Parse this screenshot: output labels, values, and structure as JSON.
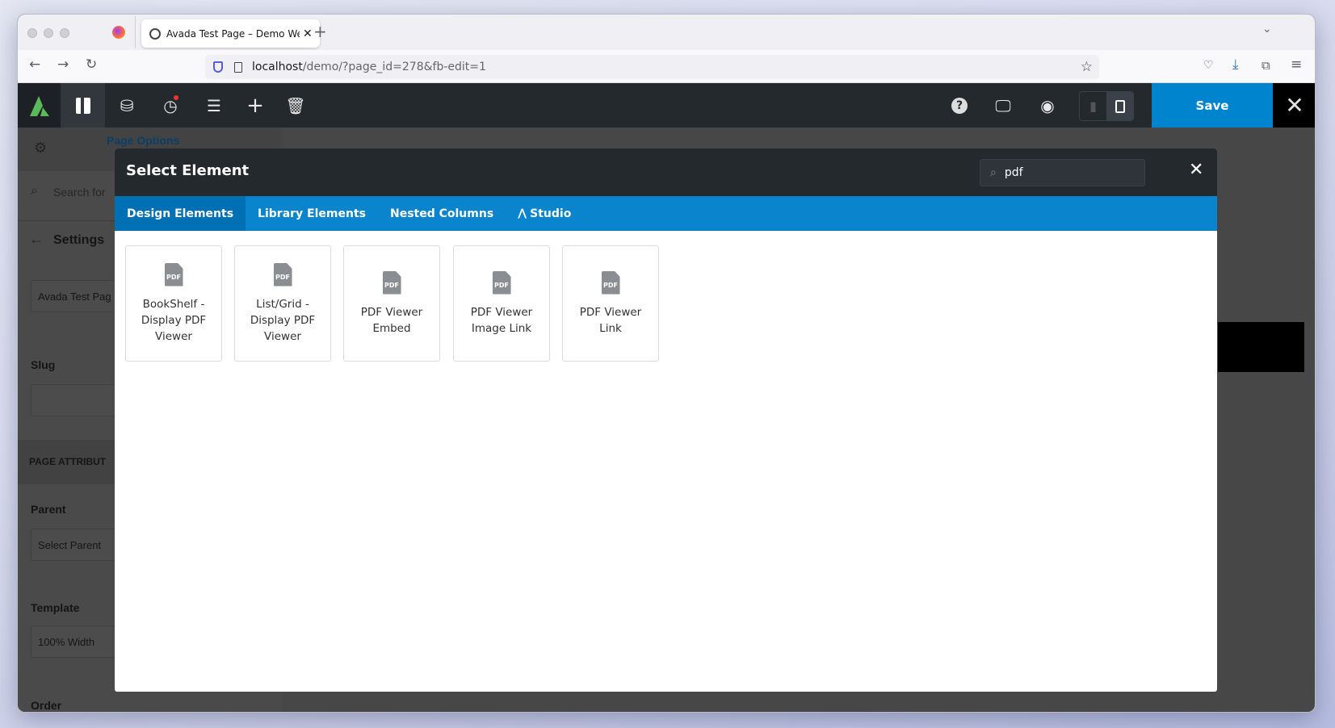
{
  "browser": {
    "tab_title": "Avada Test Page – Demo Websit",
    "url_host": "localhost",
    "url_path": "/demo/?page_id=278&fb-edit=1"
  },
  "toolbar": {
    "save_label": "Save"
  },
  "sidebar": {
    "tab_label": "Page Options",
    "search_placeholder": "Search for",
    "back_title": "Settings",
    "title_value": "Avada Test Pag",
    "slug_label": "Slug",
    "section_title": "PAGE ATTRIBUT",
    "parent_label": "Parent",
    "parent_value": "Select Parent",
    "template_label": "Template",
    "template_value": "100% Width",
    "order_label": "Order"
  },
  "modal": {
    "title": "Select Element",
    "search_value": "pdf",
    "tabs": [
      {
        "label": "Design Elements"
      },
      {
        "label": "Library Elements"
      },
      {
        "label": "Nested Columns"
      },
      {
        "label": "Studio"
      }
    ],
    "icon_text": "PDF",
    "elements": [
      {
        "label": "BookShelf - Display PDF Viewer"
      },
      {
        "label": "List/Grid - Display PDF Viewer"
      },
      {
        "label": "PDF Viewer Embed"
      },
      {
        "label": "PDF Viewer Image Link"
      },
      {
        "label": "PDF Viewer Link"
      }
    ]
  },
  "colors": {
    "accent": "#0084cd",
    "toolbar": "#24292e",
    "logo": "#5cb85c"
  }
}
